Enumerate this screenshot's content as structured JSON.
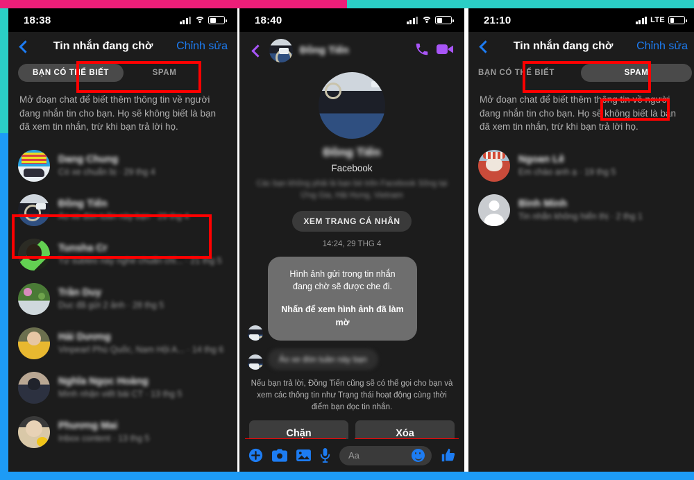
{
  "frame": {
    "colors": {
      "pink": "#ed1e79",
      "teal": "#2bcfc6",
      "blue": "#1d9bf6",
      "highlight": "#ff0000"
    }
  },
  "panels": [
    {
      "id": "pending-messages-list",
      "status_bar": {
        "time": "18:38",
        "network": "",
        "battery_icon": "battery-icon",
        "wifi_icon": "wifi-icon",
        "signal_icon": "signal-bars-icon"
      },
      "nav": {
        "back_icon": "back-chevron-icon",
        "title": "Tin nhắn đang chờ",
        "edit_label": "Chỉnh sửa"
      },
      "tabs": [
        {
          "label": "BẠN CÓ THỂ BIẾT",
          "active": true
        },
        {
          "label": "SPAM",
          "active": false
        }
      ],
      "blurb": "Mở đoạn chat để biết thêm thông tin về người đang nhắn tin cho bạn. Họ sẽ không biết là bạn đã xem tin nhắn, trừ khi bạn trả lời họ.",
      "rows": [
        {
          "name": "Dang Chung",
          "preview": "Có xe chuẩn bị · 29 thg 4",
          "avatar": "van-avatar",
          "highlighted": false
        },
        {
          "name": "Đồng Tiến",
          "preview": "Ảo xe đón tuần này bạn · 29 thg 4",
          "avatar": "car-avatar",
          "highlighted": true
        },
        {
          "name": "Tunsha Cr",
          "preview": "Tư subteo này nghe chuẩn chỉ... · 21 thg 5",
          "avatar": "green-avatar",
          "highlighted": false
        },
        {
          "name": "Trần Duy",
          "preview": "Duc đã gửi 2 ảnh · 28 thg 5",
          "avatar": "flower-avatar",
          "highlighted": false
        },
        {
          "name": "Hải Dương",
          "preview": "Vinpearl Phú Quốc, Nam Hội A... · 14 thg 6",
          "avatar": "baby-avatar",
          "highlighted": false
        },
        {
          "name": "Nghĩa Ngọc Hoàng",
          "preview": "Mình nhận viết bài CT · 13 thg 5",
          "avatar": "man-avatar",
          "highlighted": false
        },
        {
          "name": "Phương Mai",
          "preview": "Inbox content · 13 thg 5",
          "avatar": "woman-avatar",
          "highlighted": false
        }
      ]
    },
    {
      "id": "conversation-detail",
      "status_bar": {
        "time": "18:40",
        "network": "",
        "battery_icon": "battery-icon",
        "wifi_icon": "wifi-icon",
        "signal_icon": "signal-bars-icon"
      },
      "nav": {
        "back_icon": "back-chevron-icon",
        "contact_name": "Đồng Tiến",
        "call_icon": "phone-call-icon",
        "video_icon": "video-camera-icon"
      },
      "profile": {
        "name": "Đồng Tiến",
        "source": "Facebook",
        "description": "Các bạn không phải là bạn bè trên Facebook\nSống tại Ứng Gia, Hải Hưng, Vietnam",
        "view_profile_label": "XEM TRANG CÁ NHÂN"
      },
      "timestamp": "14:24, 29 THG 4",
      "bubble": {
        "line1": "Hình ảnh gửi trong tin nhắn đang chờ sẽ được che đi.",
        "line2": "Nhấn để xem hình ảnh đã làm mờ"
      },
      "blurred_message": "Ảo xe đón tuần này bạn",
      "warning": "Nếu bạn trả lời, Đồng Tiến cũng sẽ có thể gọi cho bạn và xem các thông tin như Trạng thái hoạt động cùng thời điểm bạn đọc tin nhắn.",
      "actions": [
        {
          "label": "Chặn",
          "highlighted": true
        },
        {
          "label": "Xóa",
          "highlighted": true
        }
      ],
      "composer": {
        "plus_icon": "plus-circle-icon",
        "camera_icon": "camera-icon",
        "gallery_icon": "image-gallery-icon",
        "mic_icon": "microphone-icon",
        "placeholder": "Aa",
        "emoji_icon": "smiley-emoji-icon",
        "like_icon": "thumbs-up-icon"
      }
    },
    {
      "id": "spam-messages-list",
      "status_bar": {
        "time": "21:10",
        "network": "LTE",
        "battery_icon": "battery-icon",
        "signal_icon": "signal-bars-icon"
      },
      "nav": {
        "back_icon": "back-chevron-icon",
        "title": "Tin nhắn đang chờ",
        "edit_label": "Chỉnh sửa"
      },
      "tabs": [
        {
          "label": "BẠN CÓ THỂ BIẾT",
          "active": false
        },
        {
          "label": "SPAM",
          "active": true
        }
      ],
      "blurb": "Mở đoạn chat để biết thêm thông tin về người đang nhắn tin cho bạn. Họ sẽ không biết là bạn đã xem tin nhắn, trừ khi bạn trả lời họ.",
      "rows": [
        {
          "name": "Ngoan Lê",
          "preview": "Em chào anh ạ · 19 thg 5",
          "avatar": "cat-avatar",
          "highlighted": false
        },
        {
          "name": "Bình Minh",
          "preview": "Tin nhắn không hiển thị · 2 thg 1",
          "avatar": "default-person-avatar",
          "highlighted": false
        }
      ]
    }
  ]
}
